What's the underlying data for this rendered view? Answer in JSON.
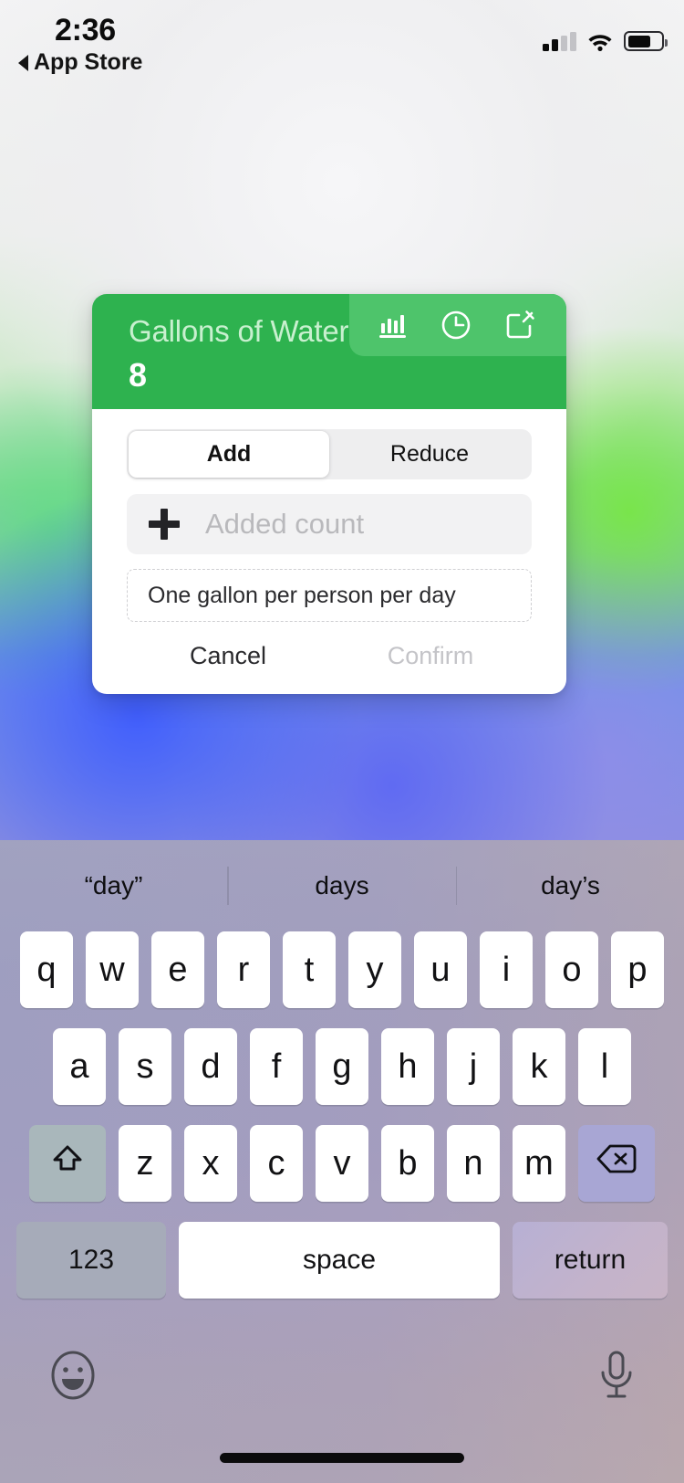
{
  "status_bar": {
    "time": "2:36",
    "back_label": "App Store",
    "back_icon": "triangle-left-icon",
    "signal_icon": "cellular-signal-icon",
    "signal_bars_filled": 2,
    "signal_bars_total": 4,
    "wifi_icon": "wifi-icon",
    "battery_icon": "battery-icon",
    "battery_level_percent": 70
  },
  "card": {
    "title": "Gallons of Water",
    "count": "8",
    "accent_color": "#2eb24f",
    "icon_bar_color": "#4ec46b",
    "title_color": "#c8f0cf",
    "header_icons": [
      {
        "name": "bar-chart-icon",
        "label": "Stats"
      },
      {
        "name": "clock-icon",
        "label": "History"
      },
      {
        "name": "compose-icon",
        "label": "Edit"
      }
    ],
    "segmented": {
      "options": [
        "Add",
        "Reduce"
      ],
      "selected": "Add",
      "add_label": "Add",
      "reduce_label": "Reduce"
    },
    "count_input": {
      "icon": "plus-icon",
      "value": "",
      "placeholder": "Added count"
    },
    "note_field": {
      "text": "One gallon per person per day"
    },
    "actions": {
      "cancel_label": "Cancel",
      "confirm_label": "Confirm",
      "confirm_enabled": false,
      "cancel_color": "#2a2a2d",
      "confirm_color": "#c4c4c8"
    }
  },
  "keyboard": {
    "suggestions": [
      "“day”",
      "days",
      "day’s"
    ],
    "row1": [
      "q",
      "w",
      "e",
      "r",
      "t",
      "y",
      "u",
      "i",
      "o",
      "p"
    ],
    "row2": [
      "a",
      "s",
      "d",
      "f",
      "g",
      "h",
      "j",
      "k",
      "l"
    ],
    "row3": [
      "z",
      "x",
      "c",
      "v",
      "b",
      "n",
      "m"
    ],
    "shift_icon": "shift-up-arrow-icon",
    "backspace_icon": "backspace-delete-icon",
    "numbers_label": "123",
    "space_label": "space",
    "return_label": "return",
    "emoji_icon": "emoji-smiley-icon",
    "dictation_icon": "microphone-icon",
    "shift_key_color": "#a9b7bb",
    "backspace_key_color": "#a8a6d4",
    "numbers_key_color": "#a6abb9"
  }
}
